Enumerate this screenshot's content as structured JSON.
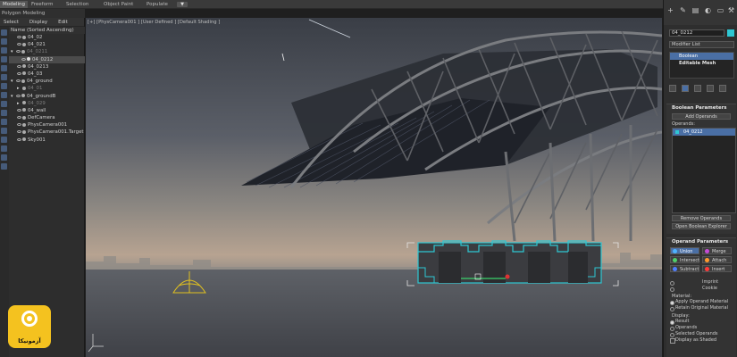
{
  "ribbon": {
    "tabs": [
      "Modeling",
      "Freeform",
      "Selection",
      "Object Paint",
      "Populate"
    ],
    "active_tab": "Modeling",
    "dropdown_glyph": "▼",
    "sub_label": "Polygon Modeling"
  },
  "explorer": {
    "menu": [
      "Select",
      "Display",
      "Edit"
    ],
    "header": "Name (Sorted Ascending)",
    "items": [
      {
        "label": "04_02"
      },
      {
        "label": "04_021"
      },
      {
        "label": "04_0211"
      },
      {
        "label": "04_0212"
      },
      {
        "label": "04_0213"
      },
      {
        "label": "04_03"
      },
      {
        "label": "04_ground"
      },
      {
        "label": "04_01"
      },
      {
        "label": "04_groundB"
      },
      {
        "label": "04_029"
      },
      {
        "label": "04_wall"
      },
      {
        "label": "DefCamera"
      },
      {
        "label": "PhysCamera001"
      },
      {
        "label": "PhysCamera001.Target"
      },
      {
        "label": "Sky001"
      }
    ]
  },
  "viewport": {
    "label": "[+] [PhysCamera001 ] [User Defined ] [Default Shading ]"
  },
  "command_panel": {
    "object_name": "04_0212",
    "object_color": "#2ec7d3",
    "modifier_list": "Modifier List",
    "stack": [
      "Boolean",
      "Editable Mesh"
    ],
    "boolean_params": {
      "title": "Boolean Parameters",
      "add_operands": "Add Operands",
      "operands_label": "Operands:",
      "operands": [
        "04_0212"
      ],
      "remove_operands": "Remove Operands",
      "open_explorer": "Open Boolean Explorer"
    },
    "operand_params": {
      "title": "Operand Parameters",
      "ops": [
        {
          "label": "Union",
          "dot": "#4fb3ff",
          "active": true
        },
        {
          "label": "Merge",
          "dot": "#c44bd6",
          "active": false
        },
        {
          "label": "Intersect",
          "dot": "#4fcf6a",
          "active": false
        },
        {
          "label": "Attach",
          "dot": "#ff9a2e",
          "active": false
        },
        {
          "label": "Subtract",
          "dot": "#4f7fff",
          "active": false
        },
        {
          "label": "Insert",
          "dot": "#ff3a3a",
          "active": false
        }
      ],
      "imprint": "Imprint",
      "cookie": "Cookie",
      "material_label": "Material:",
      "material_options": [
        "Apply Operand Material",
        "Retain Original Material"
      ],
      "display_label": "Display:",
      "display_options": [
        "Result",
        "Operands",
        "Selected Operands"
      ],
      "display_shaded": "Display as Shaded"
    }
  },
  "logo": {
    "text": "آزمونیکا"
  }
}
